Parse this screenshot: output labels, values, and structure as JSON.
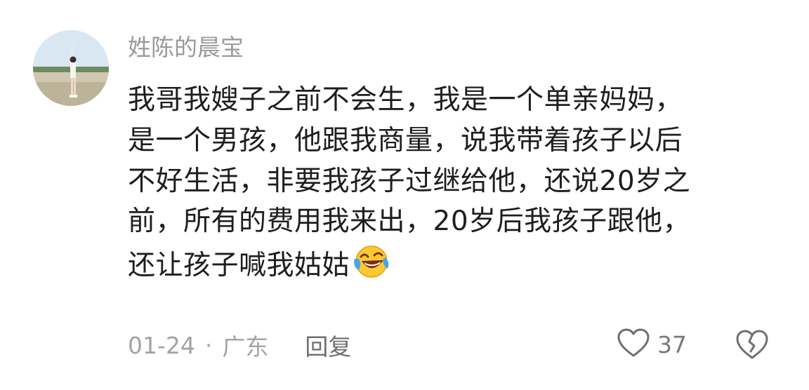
{
  "comment": {
    "author": "姓陈的晨宝",
    "avatar_icon": "avatar-photo",
    "text_lines": [
      "我哥我嫂子之前不会生，我是一个单亲妈妈，",
      "是一个男孩，他跟我商量，说我带着孩子以后",
      "不好生活，非要我孩子过继给他，还说20岁之",
      "前，所有的费用我来出，20岁后我孩子跟他，",
      "还让孩子喊我姑姑"
    ],
    "emoji_icon": "laughing-crying-emoji",
    "date": "01-24",
    "separator": "·",
    "location": "广东",
    "reply_label": "回复",
    "like_icon": "heart-outline-icon",
    "like_count": "37",
    "dislike_icon": "broken-heart-icon"
  },
  "colors": {
    "author": "#9a9a9a",
    "text": "#1e1e1e",
    "meta": "#a3a3a3",
    "reply": "#6e6e6e",
    "icon_stroke": "#6f6f6f"
  }
}
